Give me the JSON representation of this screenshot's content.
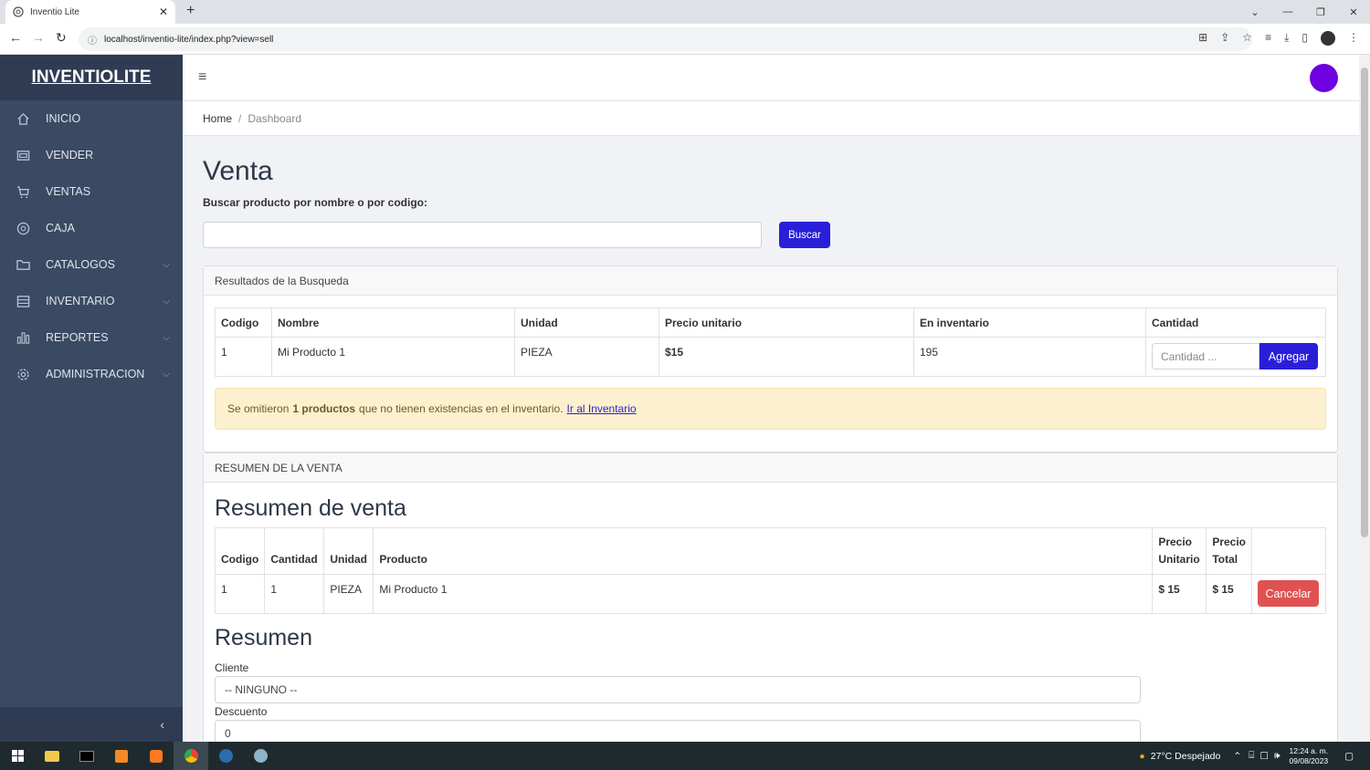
{
  "browser": {
    "tab_title": "Inventio Lite",
    "url": "localhost/inventio-lite/index.php?view=sell"
  },
  "sidebar": {
    "brand": "INVENTIOLITE",
    "items": [
      {
        "label": "INICIO",
        "icon": "home-icon",
        "has_children": false
      },
      {
        "label": "VENDER",
        "icon": "cash-register-icon",
        "has_children": false
      },
      {
        "label": "VENTAS",
        "icon": "cart-icon",
        "has_children": false
      },
      {
        "label": "CAJA",
        "icon": "safe-icon",
        "has_children": false
      },
      {
        "label": "CATALOGOS",
        "icon": "folder-icon",
        "has_children": true
      },
      {
        "label": "INVENTARIO",
        "icon": "list-icon",
        "has_children": true
      },
      {
        "label": "REPORTES",
        "icon": "bar-chart-icon",
        "has_children": true
      },
      {
        "label": "ADMINISTRACION",
        "icon": "gear-icon",
        "has_children": true
      }
    ]
  },
  "breadcrumb": {
    "home": "Home",
    "separator": "/",
    "current": "Dashboard"
  },
  "page": {
    "title": "Venta",
    "search_label": "Buscar producto por nombre o por codigo:",
    "search_value": "",
    "search_button": "Buscar"
  },
  "results": {
    "header": "Resultados de la Busqueda",
    "columns": [
      "Codigo",
      "Nombre",
      "Unidad",
      "Precio unitario",
      "En inventario",
      "Cantidad"
    ],
    "rows": [
      {
        "codigo": "1",
        "nombre": "Mi Producto 1",
        "unidad": "PIEZA",
        "precio": "$15",
        "inventario": "195",
        "cantidad_placeholder": "Cantidad ...",
        "add_button": "Agregar"
      }
    ],
    "alert": {
      "prefix": "Se omitieron",
      "bold": "1 productos",
      "suffix": "que no tienen existencias en el inventario.",
      "link": "Ir al Inventario"
    }
  },
  "summary": {
    "header": "RESUMEN DE LA VENTA",
    "title": "Resumen de venta",
    "columns": [
      "Codigo",
      "Cantidad",
      "Unidad",
      "Producto",
      "Precio Unitario",
      "Precio Total",
      ""
    ],
    "rows": [
      {
        "codigo": "1",
        "cantidad": "1",
        "unidad": "PIEZA",
        "producto": "Mi Producto 1",
        "precio_unitario": "$ 15",
        "precio_total": "$ 15",
        "cancel_button": "Cancelar"
      }
    ],
    "resumen_title": "Resumen",
    "cliente_label": "Cliente",
    "cliente_value": "-- NINGUNO --",
    "descuento_label": "Descuento",
    "descuento_value": "0"
  },
  "taskbar": {
    "weather": "27°C  Despejado",
    "time": "12:24 a. m.",
    "date": "09/08/2023"
  },
  "colors": {
    "sidebar": "#3b4a63",
    "brand_bg": "#2e3b52",
    "primary": "#2a1fd8",
    "danger": "#e05252",
    "alert_bg": "#fdf0cf",
    "avatar": "#6f00e0"
  }
}
